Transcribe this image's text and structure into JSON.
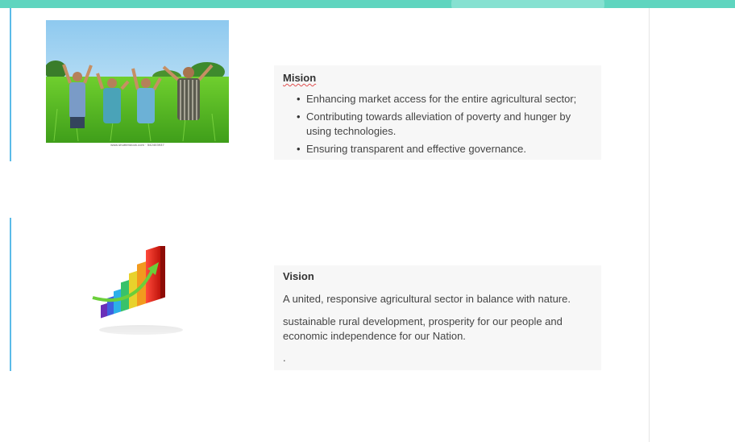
{
  "mission": {
    "title": "Mision",
    "items": [
      "Enhancing market access for the entire agricultural sector;",
      "Contributing towards alleviation of poverty and hunger by using technologies.",
      "Ensuring transparent and effective governance."
    ],
    "image_caption": "www.shutterstock.com · 542403937",
    "image_watermark": "shutterstock"
  },
  "vision": {
    "title": "Vision",
    "paragraphs": [
      "A united, responsive agricultural sector in balance with nature.",
      "sustainable rural development, prosperity for our people and economic independence for our Nation.",
      "."
    ]
  },
  "colors": {
    "top_bar": "#5fd5bf",
    "accent_line": "#5bbbe8",
    "card_bg": "#f7f7f7",
    "spellcheck_underline": "#e05050"
  },
  "icons": {
    "mission_image": "farmers-in-rice-field-photo",
    "vision_image": "growth-bar-chart-icon"
  }
}
